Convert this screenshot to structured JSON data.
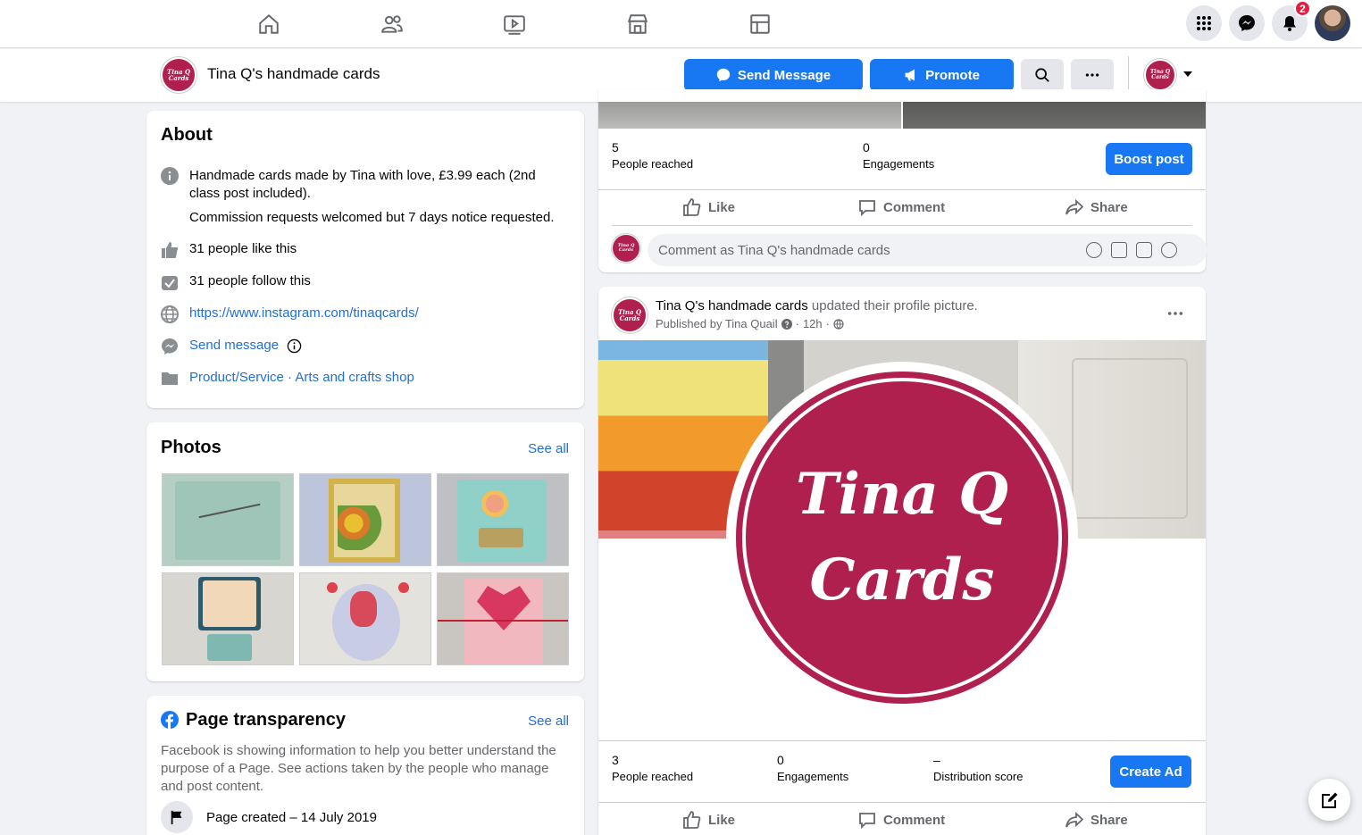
{
  "topnav": {
    "icons": [
      "home-icon",
      "friends-icon",
      "watch-icon",
      "marketplace-icon",
      "gaming-icon"
    ],
    "notif_count": "2"
  },
  "pagebar": {
    "logo_text": "Tina Q Cards",
    "title": "Tina Q's handmade cards",
    "send_message": "Send Message",
    "promote": "Promote"
  },
  "about": {
    "heading": "About",
    "description_1": "Handmade cards made by Tina with love, £3.99 each (2nd class post included).",
    "description_2": "Commission requests welcomed but 7 days notice requested.",
    "likes": "31 people like this",
    "follows": "31 people follow this",
    "website": "https://www.instagram.com/tinaqcards/",
    "send_message": "Send message",
    "category_1": "Product/Service",
    "category_sep": " · ",
    "category_2": "Arts and crafts shop"
  },
  "photos": {
    "heading": "Photos",
    "see_all": "See all"
  },
  "transparency": {
    "heading": "Page transparency",
    "see_all": "See all",
    "body": "Facebook is showing information to help you better understand the purpose of a Page. See actions taken by the people who manage and post content.",
    "created": "Page created – 14 July 2019"
  },
  "post1": {
    "reached_num": "5",
    "reached_label": "People reached",
    "engagements_num": "0",
    "engagements_label": "Engagements",
    "boost": "Boost post",
    "like": "Like",
    "comment": "Comment",
    "share": "Share",
    "comment_placeholder": "Comment as Tina Q's handmade cards"
  },
  "post2": {
    "author": "Tina Q's handmade cards",
    "action": " updated their profile picture.",
    "published_by": "Published by Tina Quail",
    "time": "12h",
    "image_line1": "Tina Q",
    "image_line2": "Cards",
    "reached_num": "3",
    "reached_label": "People reached",
    "engagements_num": "0",
    "engagements_label": "Engagements",
    "distribution_num": "–",
    "distribution_label": "Distribution score",
    "create_ad": "Create Ad",
    "like": "Like",
    "comment": "Comment",
    "share": "Share"
  },
  "colors": {
    "brand_blue": "#1877f2",
    "logo_red": "#b0204e",
    "link": "#216fdb"
  }
}
